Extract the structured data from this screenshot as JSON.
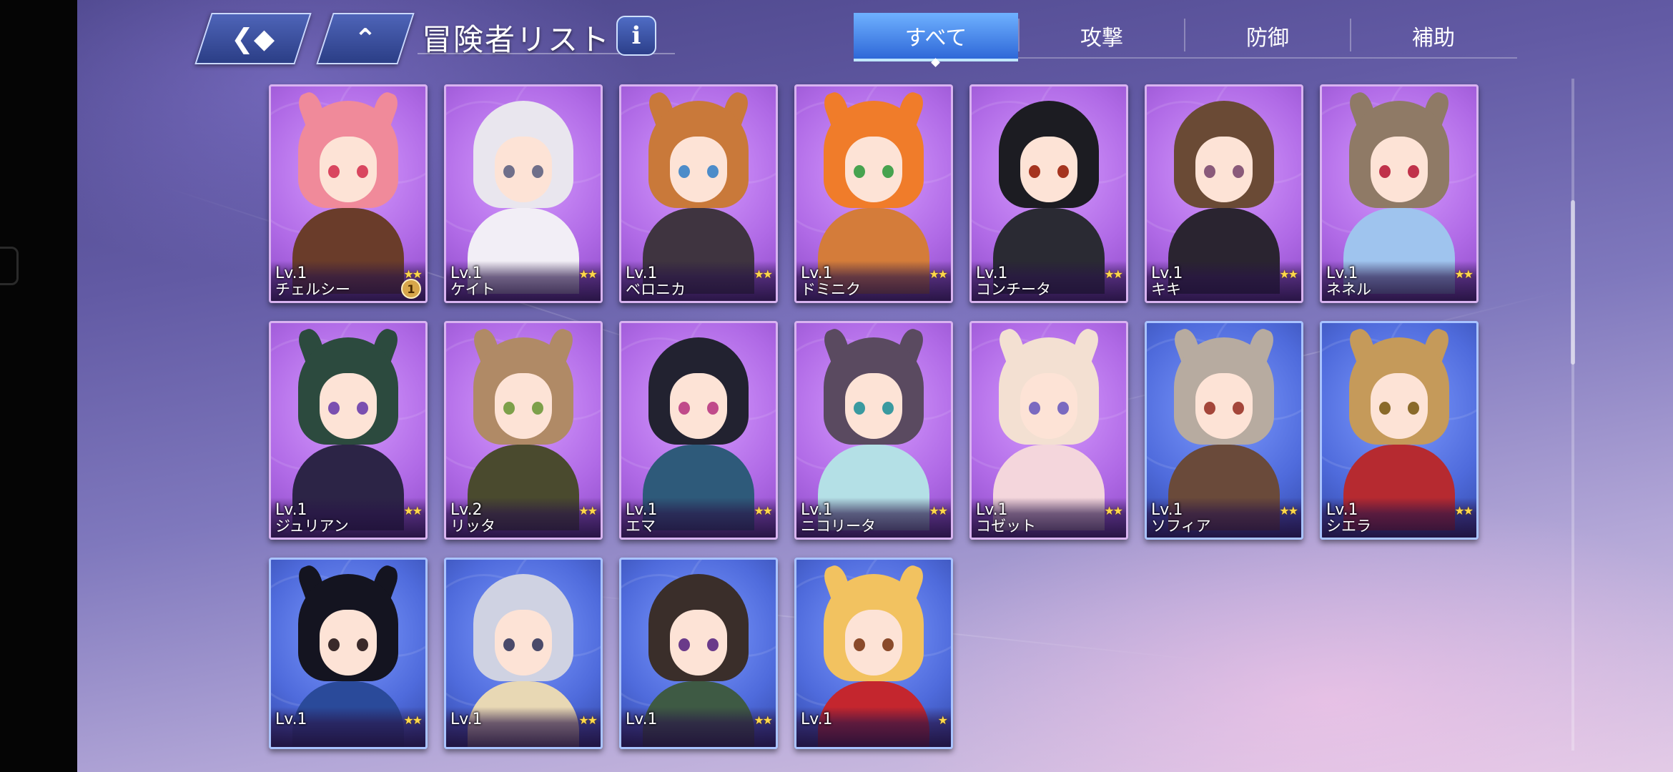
{
  "header": {
    "back_icon": "back-arrow-icon",
    "home_icon": "home-icon",
    "title": "冒険者リスト",
    "info_label": "i"
  },
  "tabs": [
    {
      "label": "すべて",
      "active": true
    },
    {
      "label": "攻撃",
      "active": false
    },
    {
      "label": "防御",
      "active": false
    },
    {
      "label": "補助",
      "active": false
    }
  ],
  "characters": [
    {
      "level": "Lv.1",
      "name": "チェルシー",
      "stars": 2,
      "badge": "1",
      "frame": "purple",
      "hair": "#f08a9a",
      "outfit": "#6a3c2a",
      "eye": "#d9465f",
      "ears": true
    },
    {
      "level": "Lv.1",
      "name": "ケイト",
      "stars": 2,
      "frame": "purple",
      "hair": "#e9e6ee",
      "outfit": "#f2eef6",
      "eye": "#6f6f8a",
      "ears": false
    },
    {
      "level": "Lv.1",
      "name": "ベロニカ",
      "stars": 2,
      "frame": "purple",
      "hair": "#c9793a",
      "outfit": "#3f3440",
      "eye": "#4d8cc9",
      "ears": true
    },
    {
      "level": "Lv.1",
      "name": "ドミニク",
      "stars": 2,
      "frame": "purple",
      "hair": "#f07c2a",
      "outfit": "#d47c3a",
      "eye": "#47a34f",
      "ears": true
    },
    {
      "level": "Lv.1",
      "name": "コンチータ",
      "stars": 2,
      "frame": "purple",
      "hair": "#1c1c22",
      "outfit": "#2a2a33",
      "eye": "#a5341f",
      "ears": false
    },
    {
      "level": "Lv.1",
      "name": "キキ",
      "stars": 2,
      "frame": "purple",
      "hair": "#6a4a35",
      "outfit": "#2a2430",
      "eye": "#8a5a7a",
      "ears": false
    },
    {
      "level": "Lv.1",
      "name": "ネネル",
      "stars": 2,
      "frame": "purple",
      "hair": "#8f7a66",
      "outfit": "#9fc4ee",
      "eye": "#c0324a",
      "ears": true
    },
    {
      "level": "Lv.1",
      "name": "ジュリアン",
      "stars": 2,
      "frame": "purple",
      "hair": "#2c4a3e",
      "outfit": "#2c2446",
      "eye": "#7a4fb0",
      "ears": true
    },
    {
      "level": "Lv.2",
      "name": "リッタ",
      "stars": 2,
      "frame": "purple",
      "hair": "#b08a66",
      "outfit": "#4a4a2e",
      "eye": "#7da04a",
      "ears": true
    },
    {
      "level": "Lv.1",
      "name": "エマ",
      "stars": 2,
      "frame": "purple",
      "hair": "#222230",
      "outfit": "#2e5a7a",
      "eye": "#c04a8a",
      "ears": false
    },
    {
      "level": "Lv.1",
      "name": "ニコリータ",
      "stars": 2,
      "frame": "purple",
      "hair": "#5a4a60",
      "outfit": "#b4e0e6",
      "eye": "#3a9aa0",
      "ears": true
    },
    {
      "level": "Lv.1",
      "name": "コゼット",
      "stars": 2,
      "frame": "purple",
      "hair": "#f3e0d2",
      "outfit": "#f4d6dc",
      "eye": "#7a6ac0",
      "ears": true
    },
    {
      "level": "Lv.1",
      "name": "ソフィア",
      "stars": 2,
      "frame": "blue",
      "hair": "#b7aba0",
      "outfit": "#6a4a3a",
      "eye": "#a4463a",
      "ears": true
    },
    {
      "level": "Lv.1",
      "name": "シエラ",
      "stars": 2,
      "frame": "blue",
      "hair": "#c59a5a",
      "outfit": "#b62a30",
      "eye": "#8a6a2a",
      "ears": true
    },
    {
      "level": "Lv.1",
      "name": "",
      "stars": 2,
      "frame": "blue",
      "hair": "#141420",
      "outfit": "#2a4a9a",
      "eye": "#3a2a2a",
      "ears": true
    },
    {
      "level": "Lv.1",
      "name": "",
      "stars": 2,
      "frame": "blue",
      "hair": "#cfd2e2",
      "outfit": "#e8d8b4",
      "eye": "#4a4a6a",
      "ears": false
    },
    {
      "level": "Lv.1",
      "name": "",
      "stars": 2,
      "frame": "blue",
      "hair": "#3a2e2a",
      "outfit": "#3e5a44",
      "eye": "#6a3a8a",
      "ears": false
    },
    {
      "level": "Lv.1",
      "name": "",
      "stars": 1,
      "frame": "blue",
      "hair": "#f2c260",
      "outfit": "#c4262e",
      "eye": "#8a4a2a",
      "ears": true
    }
  ]
}
